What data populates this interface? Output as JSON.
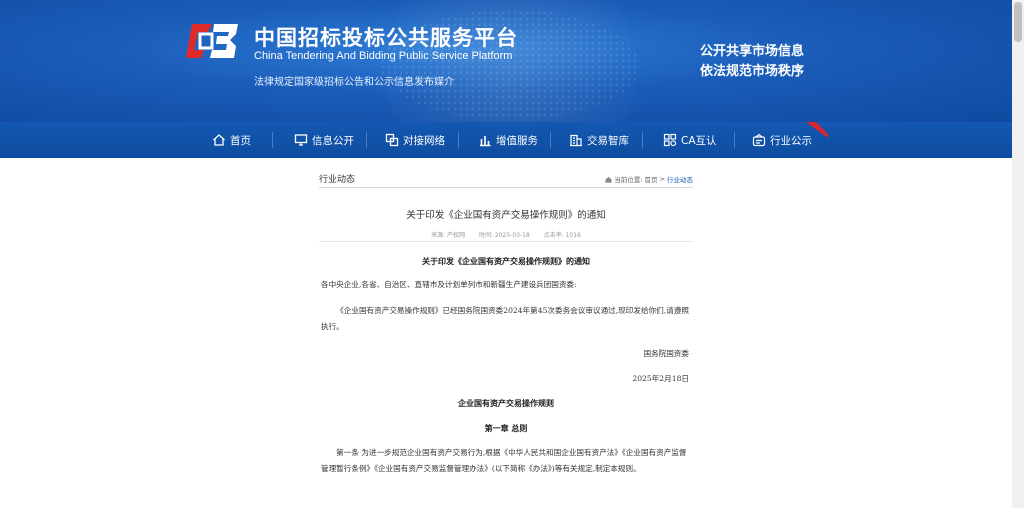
{
  "header": {
    "site_title": "中国招标投标公共服务平台",
    "site_title_en": "China Tendering And Bidding Public Service Platform",
    "site_subtitle": "法律规定国家级招标公告和公示信息发布媒介",
    "slogan_1": "公开共享市场信息",
    "slogan_2": "依法规范市场秩序",
    "logo_icon": "cbi-logo-icon",
    "accent_color": "#1a5cb8",
    "logo_red": "#e02a2a"
  },
  "nav": {
    "items": [
      {
        "label": "首页",
        "icon": "home-icon"
      },
      {
        "label": "信息公开",
        "icon": "monitor-icon"
      },
      {
        "label": "对接网络",
        "icon": "network-icon"
      },
      {
        "label": "增值服务",
        "icon": "chart-icon"
      },
      {
        "label": "交易智库",
        "icon": "building-icon"
      },
      {
        "label": "CA互认",
        "icon": "grid-icon"
      },
      {
        "label": "行业公示",
        "icon": "bulletin-icon"
      }
    ]
  },
  "content": {
    "section_title": "行业动态",
    "breadcrumb": {
      "prefix": "当前位置:",
      "home": "首页",
      "separator": ">",
      "current": "行业动态"
    },
    "article_title": "关于印发《企业国有资产交易操作规则》的通知",
    "meta": {
      "source": "来源: 产权网",
      "time": "时间: 2025-03-18",
      "clicks": "点击率: 1016"
    },
    "heading_1": "关于印发《企业国有资产交易操作规则》的通知",
    "addressee": "各中央企业,各省、自治区、直辖市及计划单列市和新疆生产建设兵团国资委:",
    "para_1": "《企业国有资产交易操作规则》已经国务院国资委2024年第45次委务会议审议通过,现印发给你们,请遵照执行。",
    "signature": "国务院国资委",
    "date": "2025年2月18日",
    "heading_2": "企业国有资产交易操作规则",
    "chapter_1": "第一章 总则",
    "article_1": "第一条 为进一步规范企业国有资产交易行为,根据《中华人民共和国企业国有资产法》《企业国有资产监督管理暂行条例》《企业国有资产交易监督管理办法》(以下简称《办法》)等有关规定,制定本规则。"
  }
}
